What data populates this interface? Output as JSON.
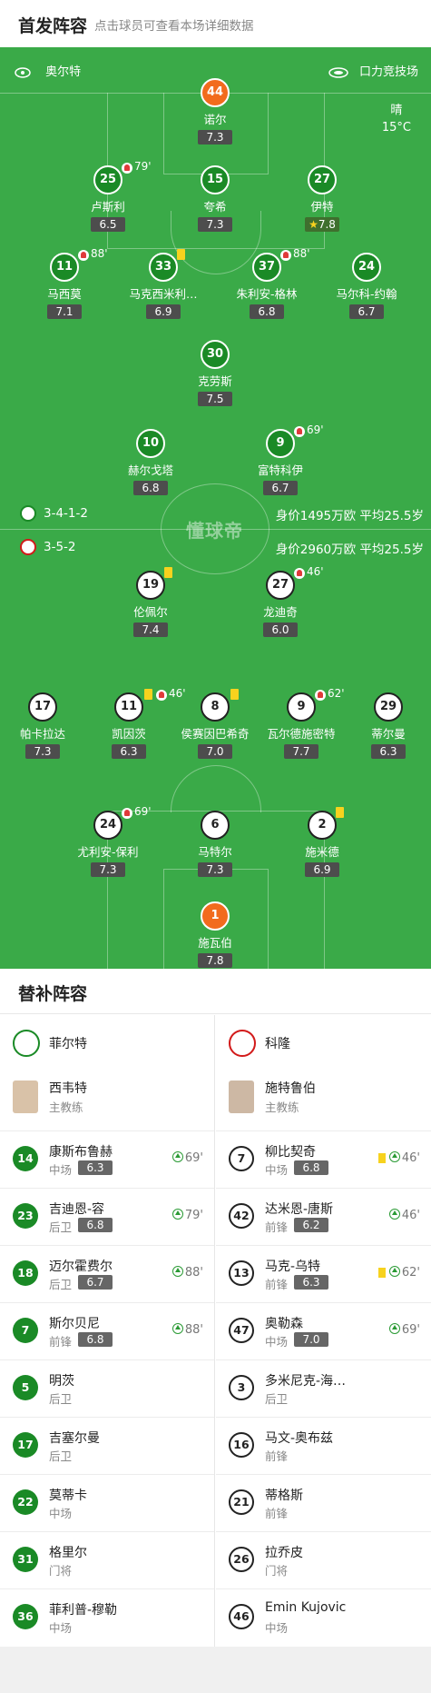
{
  "header": {
    "title": "首发阵容",
    "subtitle": "点击球员可查看本场详细数据"
  },
  "pitch": {
    "away_team": "奥尔特",
    "venue": "口力竞技场",
    "weather": "晴",
    "temperature": "15°C",
    "watermark": "懂球帝",
    "away_formation": "3-4-1-2",
    "away_info": "身价1495万欧 平均25.5岁",
    "home_formation": "3-5-2",
    "home_info": "身价2960万欧 平均25.5岁"
  },
  "players_top": [
    {
      "num": "44",
      "name": "诺尔",
      "rating": "7.3",
      "gk": true
    },
    {
      "num": "25",
      "name": "卢斯利",
      "rating": "6.5",
      "sub_min": "79'"
    },
    {
      "num": "15",
      "name": "夸希",
      "rating": "7.3"
    },
    {
      "num": "27",
      "name": "伊特",
      "rating": "7.8",
      "star": true
    },
    {
      "num": "11",
      "name": "马西莫",
      "rating": "7.1",
      "sub_min": "88'"
    },
    {
      "num": "33",
      "name": "马克西米利…",
      "rating": "6.9"
    },
    {
      "num": "37",
      "name": "朱利安-格林",
      "rating": "6.8",
      "sub_min": "88'"
    },
    {
      "num": "24",
      "name": "马尔科-约翰",
      "rating": "6.7"
    },
    {
      "num": "30",
      "name": "克劳斯",
      "rating": "7.5"
    },
    {
      "num": "10",
      "name": "赫尔戈塔",
      "rating": "6.8"
    },
    {
      "num": "9",
      "name": "富特科伊",
      "rating": "6.7",
      "sub_min": "69'"
    }
  ],
  "players_bottom": [
    {
      "num": "19",
      "name": "伦佩尔",
      "rating": "7.4"
    },
    {
      "num": "27",
      "name": "龙迪奇",
      "rating": "6.0",
      "sub_min": "46'"
    },
    {
      "num": "17",
      "name": "帕卡拉达",
      "rating": "7.3"
    },
    {
      "num": "11",
      "name": "凯因茨",
      "rating": "6.3",
      "sub_min": "46'"
    },
    {
      "num": "8",
      "name": "侯赛因巴希奇",
      "rating": "7.0"
    },
    {
      "num": "9",
      "name": "瓦尔德施密特",
      "rating": "7.7",
      "sub_min": "62'"
    },
    {
      "num": "29",
      "name": "蒂尔曼",
      "rating": "6.3"
    },
    {
      "num": "24",
      "name": "尤利安-保利",
      "rating": "7.3",
      "sub_min": "69'"
    },
    {
      "num": "6",
      "name": "马特尔",
      "rating": "7.3"
    },
    {
      "num": "2",
      "name": "施米德",
      "rating": "6.9"
    },
    {
      "num": "1",
      "name": "施瓦伯",
      "rating": "7.8",
      "gk": true
    }
  ],
  "subs": {
    "title": "替补阵容",
    "left": {
      "team": "菲尔特",
      "coach": {
        "name": "西韦特",
        "role": "主教练"
      },
      "players": [
        {
          "num": "14",
          "name": "康斯布鲁赫",
          "pos": "中场",
          "rating": "6.3",
          "in": "69'"
        },
        {
          "num": "23",
          "name": "吉迪恩-容",
          "pos": "后卫",
          "rating": "6.8",
          "in": "79'"
        },
        {
          "num": "18",
          "name": "迈尔霍费尔",
          "pos": "后卫",
          "rating": "6.7",
          "in": "88'"
        },
        {
          "num": "7",
          "name": "斯尔贝尼",
          "pos": "前锋",
          "rating": "6.8",
          "in": "88'"
        },
        {
          "num": "5",
          "name": "明茨",
          "pos": "后卫"
        },
        {
          "num": "17",
          "name": "吉塞尔曼",
          "pos": "后卫"
        },
        {
          "num": "22",
          "name": "莫蒂卡",
          "pos": "中场"
        },
        {
          "num": "31",
          "name": "格里尔",
          "pos": "门将"
        },
        {
          "num": "36",
          "name": "菲利普-穆勒",
          "pos": "中场"
        }
      ]
    },
    "right": {
      "team": "科隆",
      "coach": {
        "name": "施特鲁伯",
        "role": "主教练"
      },
      "players": [
        {
          "num": "7",
          "name": "柳比契奇",
          "pos": "中场",
          "rating": "6.8",
          "in": "46'",
          "yellow": true
        },
        {
          "num": "42",
          "name": "达米恩-唐斯",
          "pos": "前锋",
          "rating": "6.2",
          "in": "46'"
        },
        {
          "num": "13",
          "name": "马克-乌特",
          "pos": "前锋",
          "rating": "6.3",
          "in": "62'",
          "yellow": true
        },
        {
          "num": "47",
          "name": "奥勒森",
          "pos": "中场",
          "rating": "7.0",
          "in": "69'"
        },
        {
          "num": "3",
          "name": "多米尼克-海…",
          "pos": "后卫"
        },
        {
          "num": "16",
          "name": "马文-奥布兹",
          "pos": "前锋"
        },
        {
          "num": "21",
          "name": "蒂格斯",
          "pos": "前锋"
        },
        {
          "num": "26",
          "name": "拉乔皮",
          "pos": "门将"
        },
        {
          "num": "46",
          "name": "Emin Kujovic",
          "pos": "中场"
        }
      ]
    }
  }
}
